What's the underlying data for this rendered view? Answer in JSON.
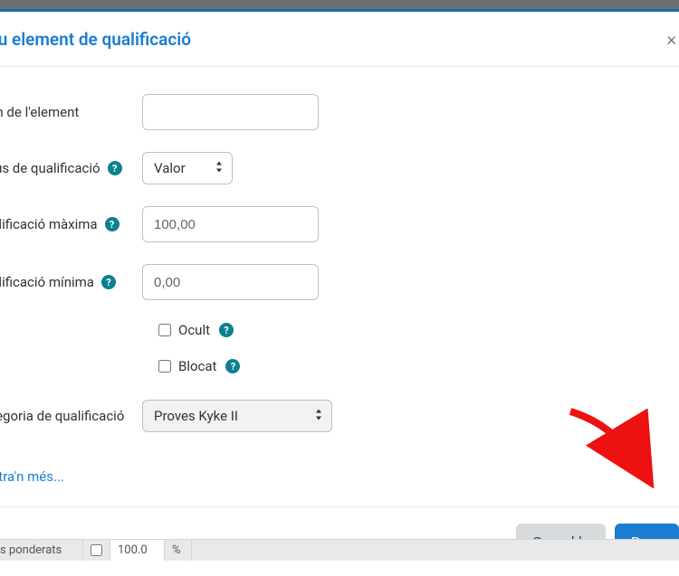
{
  "modal": {
    "title": "lou element de qualificació",
    "close_label": "×"
  },
  "form": {
    "name_label": "om de l'element",
    "name_value": "",
    "type_label": "ipus de qualificació",
    "type_value": "Valor",
    "max_label": "ualificació màxima",
    "max_value": "100,00",
    "min_label": "ualificació mínima",
    "min_value": "0,00",
    "hidden_label": "Ocult",
    "locked_label": "Blocat",
    "category_label": "ategoria de qualificació",
    "category_value": "Proves Kyke II",
    "show_more": "ostra'n més..."
  },
  "footer": {
    "cancel": "Cancel·la",
    "save": "Desa"
  },
  "bg": {
    "label": "s ponderats",
    "val": "100.0",
    "unit": "%"
  },
  "icons": {
    "help": "?",
    "caret": "◆"
  }
}
